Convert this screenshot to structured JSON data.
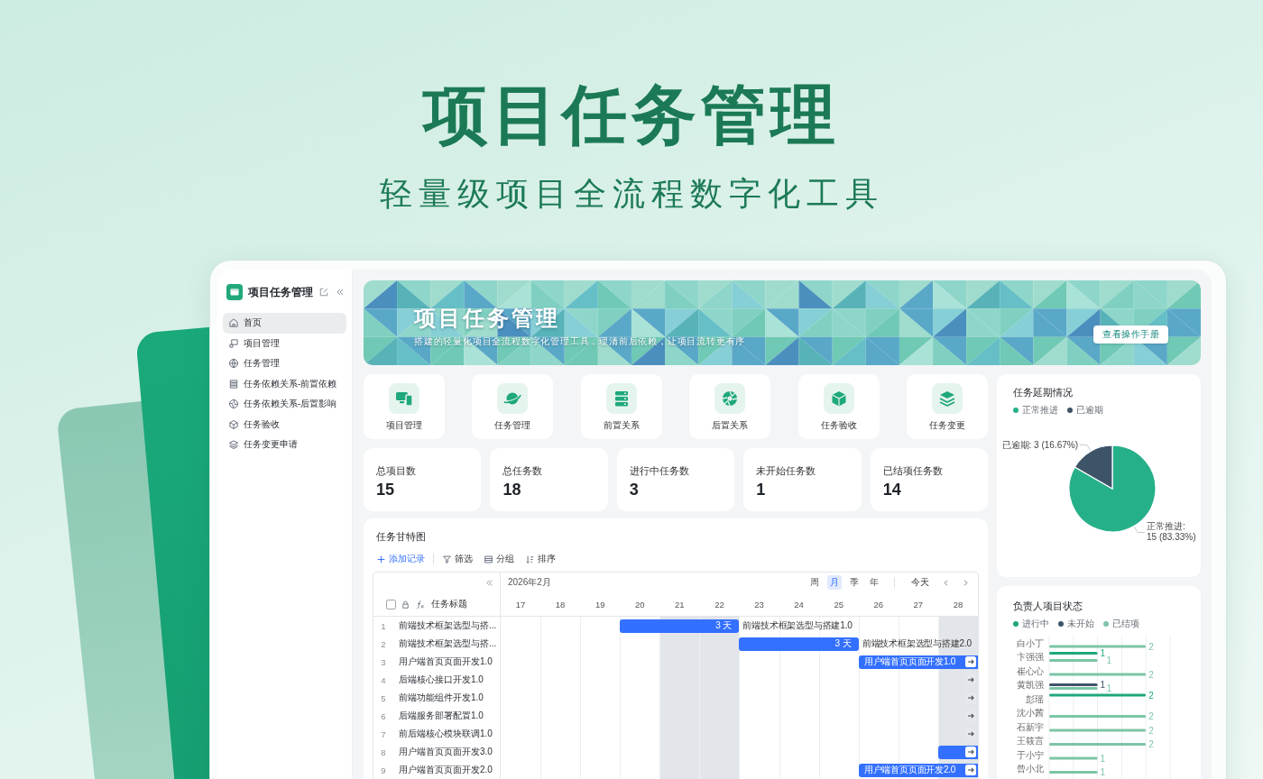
{
  "hero": {
    "title": "项目任务管理",
    "subtitle": "轻量级项目全流程数字化工具"
  },
  "sidebar": {
    "title": "项目任务管理",
    "items": [
      {
        "label": "首页",
        "selected": true
      },
      {
        "label": "项目管理",
        "selected": false
      },
      {
        "label": "任务管理",
        "selected": false
      },
      {
        "label": "任务依赖关系-前置依赖",
        "selected": false
      },
      {
        "label": "任务依赖关系-后置影响",
        "selected": false
      },
      {
        "label": "任务验收",
        "selected": false
      },
      {
        "label": "任务变更申请",
        "selected": false
      }
    ]
  },
  "banner": {
    "title": "项目任务管理",
    "subtitle": "搭建的轻量化项目全流程数字化管理工具，理清前后依赖，让项目流转更有序",
    "button": "查看操作手册"
  },
  "shortcuts": [
    {
      "label": "项目管理"
    },
    {
      "label": "任务管理"
    },
    {
      "label": "前置关系"
    },
    {
      "label": "后置关系"
    },
    {
      "label": "任务验收"
    },
    {
      "label": "任务变更"
    }
  ],
  "stats": [
    {
      "label": "总项目数",
      "value": "15"
    },
    {
      "label": "总任务数",
      "value": "18"
    },
    {
      "label": "进行中任务数",
      "value": "3"
    },
    {
      "label": "未开始任务数",
      "value": "1"
    },
    {
      "label": "已结项任务数",
      "value": "14"
    }
  ],
  "gantt": {
    "title": "任务甘特图",
    "toolbar": [
      {
        "kind": "add",
        "label": "添加记录"
      },
      {
        "kind": "filter",
        "label": "筛选"
      },
      {
        "kind": "group",
        "label": "分组"
      },
      {
        "kind": "sort",
        "label": "排序"
      }
    ],
    "select_all": {
      "checked": false
    },
    "column_title": "任务标题",
    "month": "2026年2月",
    "scales": [
      {
        "label": "周",
        "selected": false
      },
      {
        "label": "月",
        "selected": true
      },
      {
        "label": "季",
        "selected": false
      },
      {
        "label": "年",
        "selected": false
      }
    ],
    "today": "今天",
    "days": [
      {
        "label": "17",
        "weekend": false
      },
      {
        "label": "18",
        "weekend": false
      },
      {
        "label": "19",
        "weekend": false
      },
      {
        "label": "20",
        "weekend": false
      },
      {
        "label": "21",
        "weekend": true
      },
      {
        "label": "22",
        "weekend": true
      },
      {
        "label": "23",
        "weekend": false
      },
      {
        "label": "24",
        "weekend": false
      },
      {
        "label": "25",
        "weekend": false
      },
      {
        "label": "26",
        "weekend": false
      },
      {
        "label": "27",
        "weekend": false
      },
      {
        "label": "28",
        "weekend": true
      }
    ],
    "rows": [
      {
        "number": "1",
        "title": "前端技术框架选型与搭...",
        "kind": "span",
        "scheduled": [
          false,
          false,
          false,
          true,
          true,
          true,
          false,
          false,
          false,
          false,
          false,
          false
        ],
        "duration": "3 天",
        "caption": "前端技术框架选型与搭建1.0"
      },
      {
        "number": "2",
        "title": "前端技术框架选型与搭...",
        "kind": "span",
        "scheduled": [
          false,
          false,
          false,
          false,
          false,
          false,
          true,
          true,
          true,
          false,
          false,
          false
        ],
        "duration": "3 天",
        "caption": "前端技术框架选型与搭建2.0"
      },
      {
        "number": "3",
        "title": "用户端首页页面开发1.0",
        "kind": "overflow",
        "scheduled": [
          false,
          false,
          false,
          false,
          false,
          false,
          false,
          false,
          false,
          true,
          true,
          true
        ],
        "caption": "用户端首页页面开发1.0"
      },
      {
        "number": "4",
        "title": "后端核心接口开发1.0",
        "kind": "offscreen",
        "scheduled": [
          false,
          false,
          false,
          false,
          false,
          false,
          false,
          false,
          false,
          false,
          false,
          false
        ]
      },
      {
        "number": "5",
        "title": "前端功能组件开发1.0",
        "kind": "offscreen",
        "scheduled": [
          false,
          false,
          false,
          false,
          false,
          false,
          false,
          false,
          false,
          false,
          false,
          false
        ]
      },
      {
        "number": "6",
        "title": "后端服务部署配置1.0",
        "kind": "offscreen",
        "scheduled": [
          false,
          false,
          false,
          false,
          false,
          false,
          false,
          false,
          false,
          false,
          false,
          false
        ]
      },
      {
        "number": "7",
        "title": "前后端核心模块联调1.0",
        "kind": "offscreen",
        "scheduled": [
          false,
          false,
          false,
          false,
          false,
          false,
          false,
          false,
          false,
          false,
          false,
          false
        ]
      },
      {
        "number": "8",
        "title": "用户端首页页面开发3.0",
        "kind": "overflow",
        "scheduled": [
          false,
          false,
          false,
          false,
          false,
          false,
          false,
          false,
          false,
          false,
          false,
          true
        ]
      },
      {
        "number": "9",
        "title": "用户端首页页面开发2.0",
        "kind": "overflow",
        "scheduled": [
          false,
          false,
          false,
          false,
          false,
          false,
          false,
          false,
          false,
          true,
          true,
          true
        ],
        "caption": "用户端首页页面开发2.0"
      }
    ]
  },
  "delay_chart": {
    "legend": [
      {
        "color": "#26b08a"
      },
      {
        "color": "#3d5368"
      }
    ],
    "chart_data": {
      "type": "pie",
      "title": "任务延期情况",
      "categories": [
        "正常推进",
        "已逾期"
      ],
      "values": [
        15,
        3
      ],
      "value_labels": [
        "正常推进:\n15 (83.33%)",
        "已逾期: 3 (16.67%)"
      ]
    }
  },
  "owner_chart": {
    "chart_data": {
      "type": "bar",
      "orientation": "horizontal",
      "title": "负责人项目状态",
      "categories": [
        "白小丁",
        "卞强强",
        "崔心心",
        "黄凯强",
        "彭瑶",
        "沈小茜",
        "石新宇",
        "王筱言",
        "于小宁",
        "曾小北"
      ],
      "series": [
        {
          "name": "进行中",
          "color": "#1fa87c",
          "values": [
            null,
            1,
            null,
            null,
            2,
            null,
            null,
            null,
            null,
            null
          ]
        },
        {
          "name": "未开始",
          "color": "#3d5368",
          "values": [
            null,
            null,
            null,
            1,
            null,
            null,
            null,
            null,
            null,
            null
          ]
        },
        {
          "name": "已结项",
          "color": "#7cc5a6",
          "values": [
            2,
            1,
            2,
            1,
            null,
            2,
            2,
            2,
            1,
            1
          ]
        }
      ],
      "xlim": [
        0,
        2.5
      ],
      "data_labels": true
    }
  }
}
